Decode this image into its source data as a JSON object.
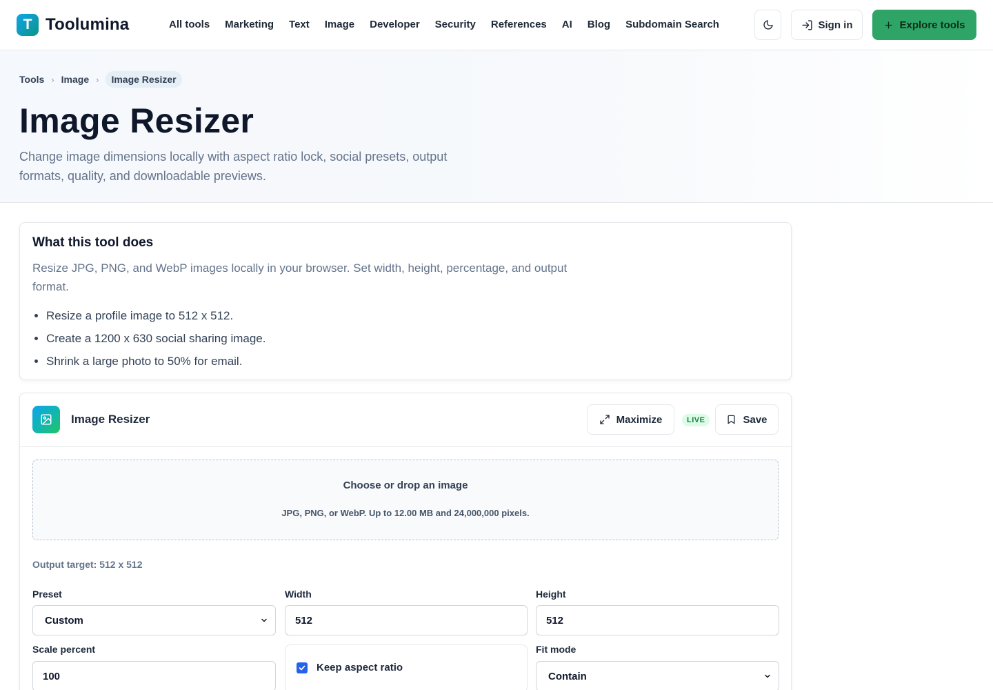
{
  "header": {
    "logo_letter": "T",
    "logo_text": "Toolumina",
    "nav": [
      "All tools",
      "Marketing",
      "Text",
      "Image",
      "Developer",
      "Security",
      "References",
      "AI",
      "Blog",
      "Subdomain Search"
    ],
    "signin_label": "Sign in",
    "explore_label": "Explore tools"
  },
  "hero": {
    "breadcrumb": [
      "Tools",
      "Image",
      "Image Resizer"
    ],
    "title": "Image Resizer",
    "description": "Change image dimensions locally with aspect ratio lock, social presets, output formats, quality, and downloadable previews."
  },
  "info": {
    "title": "What this tool does",
    "description": "Resize JPG, PNG, and WebP images locally in your browser. Set width, height, percentage, and output format.",
    "examples": [
      "Resize a profile image to 512 x 512.",
      "Create a 1200 x 630 social sharing image.",
      "Shrink a large photo to 50% for email."
    ]
  },
  "tool": {
    "name": "Image Resizer",
    "maximize_label": "Maximize",
    "live_badge": "LIVE",
    "save_label": "Save",
    "dropzone": {
      "title": "Choose or drop an image",
      "subtitle": "JPG, PNG, or WebP. Up to 12.00 MB and 24,000,000 pixels."
    },
    "output_target": "Output target: 512 x 512",
    "preset": {
      "label": "Preset",
      "value": "Custom"
    },
    "width": {
      "label": "Width",
      "value": "512"
    },
    "height": {
      "label": "Height",
      "value": "512"
    },
    "scale": {
      "label": "Scale percent",
      "value": "100"
    },
    "aspect": {
      "label": "Keep aspect ratio",
      "checked": true
    },
    "fit": {
      "label": "Fit mode",
      "value": "Contain"
    }
  },
  "icons": {
    "theme": "moon-icon",
    "signin": "login-icon",
    "explore": "plus-icon",
    "tool": "image-icon",
    "maximize": "expand-icon",
    "save": "bookmark-icon",
    "select": "chevron-down-icon",
    "checkbox": "check-icon"
  },
  "colors": {
    "accent": "#2ea567",
    "checkbox": "#2563eb",
    "live_bg": "#dcfce7",
    "live_text": "#15803d"
  }
}
